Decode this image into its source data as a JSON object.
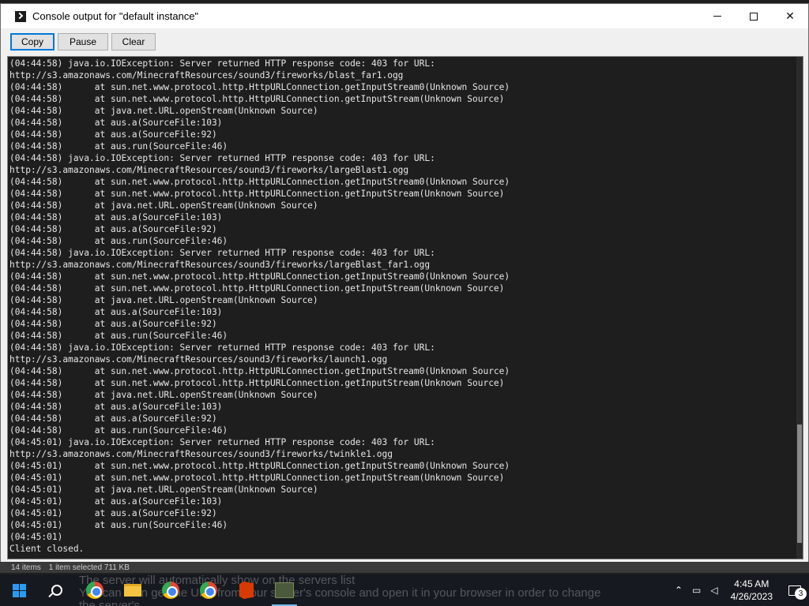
{
  "window": {
    "title": "Console output for \"default instance\"",
    "controls": {
      "minimize": "minimize",
      "maximize": "maximize",
      "close": "✕"
    }
  },
  "toolbar": {
    "copy_label": "Copy",
    "pause_label": "Pause",
    "clear_label": "Clear"
  },
  "console": {
    "lines": [
      "(04:44:58) java.io.IOException: Server returned HTTP response code: 403 for URL:",
      "http://s3.amazonaws.com/MinecraftResources/sound3/fireworks/blast_far1.ogg",
      "(04:44:58)      at sun.net.www.protocol.http.HttpURLConnection.getInputStream0(Unknown Source)",
      "(04:44:58)      at sun.net.www.protocol.http.HttpURLConnection.getInputStream(Unknown Source)",
      "(04:44:58)      at java.net.URL.openStream(Unknown Source)",
      "(04:44:58)      at aus.a(SourceFile:103)",
      "(04:44:58)      at aus.a(SourceFile:92)",
      "(04:44:58)      at aus.run(SourceFile:46)",
      "(04:44:58) java.io.IOException: Server returned HTTP response code: 403 for URL:",
      "http://s3.amazonaws.com/MinecraftResources/sound3/fireworks/largeBlast1.ogg",
      "(04:44:58)      at sun.net.www.protocol.http.HttpURLConnection.getInputStream0(Unknown Source)",
      "(04:44:58)      at sun.net.www.protocol.http.HttpURLConnection.getInputStream(Unknown Source)",
      "(04:44:58)      at java.net.URL.openStream(Unknown Source)",
      "(04:44:58)      at aus.a(SourceFile:103)",
      "(04:44:58)      at aus.a(SourceFile:92)",
      "(04:44:58)      at aus.run(SourceFile:46)",
      "(04:44:58) java.io.IOException: Server returned HTTP response code: 403 for URL:",
      "http://s3.amazonaws.com/MinecraftResources/sound3/fireworks/largeBlast_far1.ogg",
      "(04:44:58)      at sun.net.www.protocol.http.HttpURLConnection.getInputStream0(Unknown Source)",
      "(04:44:58)      at sun.net.www.protocol.http.HttpURLConnection.getInputStream(Unknown Source)",
      "(04:44:58)      at java.net.URL.openStream(Unknown Source)",
      "(04:44:58)      at aus.a(SourceFile:103)",
      "(04:44:58)      at aus.a(SourceFile:92)",
      "(04:44:58)      at aus.run(SourceFile:46)",
      "(04:44:58) java.io.IOException: Server returned HTTP response code: 403 for URL:",
      "http://s3.amazonaws.com/MinecraftResources/sound3/fireworks/launch1.ogg",
      "(04:44:58)      at sun.net.www.protocol.http.HttpURLConnection.getInputStream0(Unknown Source)",
      "(04:44:58)      at sun.net.www.protocol.http.HttpURLConnection.getInputStream(Unknown Source)",
      "(04:44:58)      at java.net.URL.openStream(Unknown Source)",
      "(04:44:58)      at aus.a(SourceFile:103)",
      "(04:44:58)      at aus.a(SourceFile:92)",
      "(04:44:58)      at aus.run(SourceFile:46)",
      "(04:45:01) java.io.IOException: Server returned HTTP response code: 403 for URL:",
      "http://s3.amazonaws.com/MinecraftResources/sound3/fireworks/twinkle1.ogg",
      "(04:45:01)      at sun.net.www.protocol.http.HttpURLConnection.getInputStream0(Unknown Source)",
      "(04:45:01)      at sun.net.www.protocol.http.HttpURLConnection.getInputStream(Unknown Source)",
      "(04:45:01)      at java.net.URL.openStream(Unknown Source)",
      "(04:45:01)      at aus.a(SourceFile:103)",
      "(04:45:01)      at aus.a(SourceFile:92)",
      "(04:45:01)      at aus.run(SourceFile:46)",
      "(04:45:01)",
      "Client closed."
    ]
  },
  "statusbar": {
    "items_count": "14 items",
    "selection": "1 item selected  711 KB"
  },
  "background_text": {
    "line1": "The server will automatically show on the servers list",
    "line2": "You can then get the URL from your server's console and open it in your browser in order to change",
    "line3": "the server's..."
  },
  "taskbar": {
    "icons": [
      "windows-start-icon",
      "search-icon",
      "chrome-icon",
      "file-explorer-icon",
      "chrome-icon",
      "chrome-icon",
      "office-icon",
      "minecraft-icon"
    ],
    "tray": {
      "time": "4:45 AM",
      "date": "4/26/2023",
      "notification_count": "3"
    }
  },
  "colors": {
    "console_bg": "#1e1e1e",
    "console_text": "#e6e6e6",
    "taskbar_bg": "#161a20",
    "accent": "#0078d7"
  }
}
